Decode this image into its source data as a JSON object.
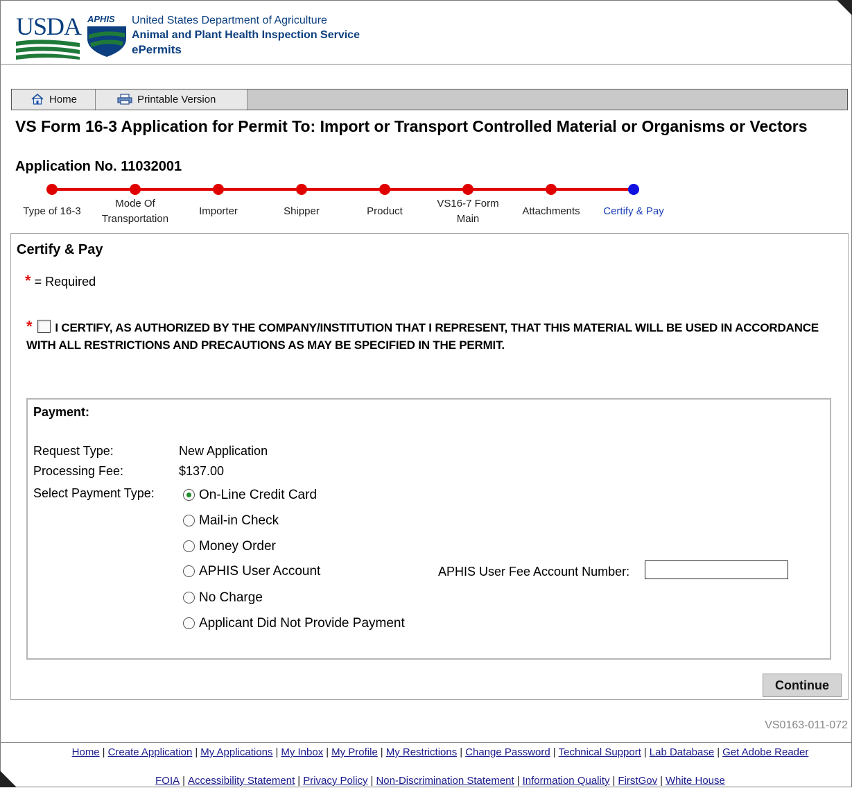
{
  "header": {
    "usda_logo_text": "USDA",
    "aphis_logo_text": "APHIS",
    "agency_line1": "United States Department of Agriculture",
    "agency_line2": "Animal and Plant Health Inspection Service",
    "agency_line3": "ePermits"
  },
  "toolbar": {
    "home_label": "Home",
    "home_icon": "home-icon",
    "print_label": "Printable Version",
    "print_icon": "printer-icon"
  },
  "page": {
    "title": "VS Form 16-3 Application for Permit To: Import or Transport Controlled Material or Organisms or Vectors",
    "application_no": "Application No. 11032001"
  },
  "stepper": {
    "completed_color": "#e00000",
    "current_color": "#1010e0",
    "steps": [
      {
        "label": "Type of 16-3",
        "state": "completed"
      },
      {
        "label": "Mode Of Transportation",
        "state": "completed"
      },
      {
        "label": "Importer",
        "state": "completed"
      },
      {
        "label": "Shipper",
        "state": "completed"
      },
      {
        "label": "Product",
        "state": "completed"
      },
      {
        "label": "VS16-7 Form Main",
        "state": "completed"
      },
      {
        "label": "Attachments",
        "state": "completed"
      },
      {
        "label": "Certify & Pay",
        "state": "current"
      }
    ]
  },
  "certify": {
    "section_title": "Certify & Pay",
    "required_star": "*",
    "required_note": "= Required",
    "certify_text": "I CERTIFY, AS AUTHORIZED BY THE COMPANY/INSTITUTION THAT I REPRESENT, THAT THIS MATERIAL WILL BE USED IN ACCORDANCE WITH ALL RESTRICTIONS AND PRECAUTIONS AS MAY BE SPECIFIED IN THE PERMIT.",
    "certify_checked": false
  },
  "payment": {
    "title": "Payment:",
    "request_type_label": "Request Type:",
    "request_type_value": "New Application",
    "fee_label": "Processing Fee:",
    "fee_value": "$137.00",
    "select_label": "Select Payment Type:",
    "options": [
      {
        "label": "On-Line Credit Card",
        "checked": true
      },
      {
        "label": "Mail-in Check",
        "checked": false
      },
      {
        "label": "Money Order",
        "checked": false
      },
      {
        "label": "APHIS User Account",
        "checked": false
      },
      {
        "label": "No Charge",
        "checked": false
      },
      {
        "label": "Applicant Did Not Provide Payment",
        "checked": false
      }
    ],
    "account_number_label": "APHIS User Fee Account Number:",
    "account_number_value": ""
  },
  "actions": {
    "continue_label": "Continue"
  },
  "page_code": "VS0163-011-072",
  "footer": {
    "row1": [
      "Home",
      "Create Application",
      "My Applications",
      "My Inbox",
      "My Profile",
      "My Restrictions",
      "Change Password",
      "Technical Support",
      "Lab Database",
      "Get Adobe Reader"
    ],
    "row2": [
      "FOIA",
      "Accessibility Statement",
      "Privacy Policy",
      "Non-Discrimination Statement",
      "Information Quality",
      "FirstGov",
      "White House"
    ]
  }
}
